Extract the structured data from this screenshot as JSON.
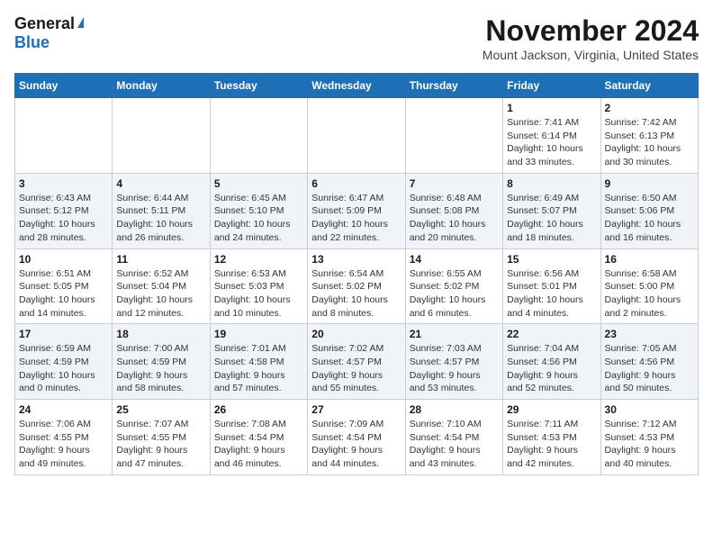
{
  "header": {
    "logo_general": "General",
    "logo_blue": "Blue",
    "month_title": "November 2024",
    "location": "Mount Jackson, Virginia, United States"
  },
  "weekdays": [
    "Sunday",
    "Monday",
    "Tuesday",
    "Wednesday",
    "Thursday",
    "Friday",
    "Saturday"
  ],
  "weeks": [
    [
      {
        "day": "",
        "info": ""
      },
      {
        "day": "",
        "info": ""
      },
      {
        "day": "",
        "info": ""
      },
      {
        "day": "",
        "info": ""
      },
      {
        "day": "",
        "info": ""
      },
      {
        "day": "1",
        "info": "Sunrise: 7:41 AM\nSunset: 6:14 PM\nDaylight: 10 hours\nand 33 minutes."
      },
      {
        "day": "2",
        "info": "Sunrise: 7:42 AM\nSunset: 6:13 PM\nDaylight: 10 hours\nand 30 minutes."
      }
    ],
    [
      {
        "day": "3",
        "info": "Sunrise: 6:43 AM\nSunset: 5:12 PM\nDaylight: 10 hours\nand 28 minutes."
      },
      {
        "day": "4",
        "info": "Sunrise: 6:44 AM\nSunset: 5:11 PM\nDaylight: 10 hours\nand 26 minutes."
      },
      {
        "day": "5",
        "info": "Sunrise: 6:45 AM\nSunset: 5:10 PM\nDaylight: 10 hours\nand 24 minutes."
      },
      {
        "day": "6",
        "info": "Sunrise: 6:47 AM\nSunset: 5:09 PM\nDaylight: 10 hours\nand 22 minutes."
      },
      {
        "day": "7",
        "info": "Sunrise: 6:48 AM\nSunset: 5:08 PM\nDaylight: 10 hours\nand 20 minutes."
      },
      {
        "day": "8",
        "info": "Sunrise: 6:49 AM\nSunset: 5:07 PM\nDaylight: 10 hours\nand 18 minutes."
      },
      {
        "day": "9",
        "info": "Sunrise: 6:50 AM\nSunset: 5:06 PM\nDaylight: 10 hours\nand 16 minutes."
      }
    ],
    [
      {
        "day": "10",
        "info": "Sunrise: 6:51 AM\nSunset: 5:05 PM\nDaylight: 10 hours\nand 14 minutes."
      },
      {
        "day": "11",
        "info": "Sunrise: 6:52 AM\nSunset: 5:04 PM\nDaylight: 10 hours\nand 12 minutes."
      },
      {
        "day": "12",
        "info": "Sunrise: 6:53 AM\nSunset: 5:03 PM\nDaylight: 10 hours\nand 10 minutes."
      },
      {
        "day": "13",
        "info": "Sunrise: 6:54 AM\nSunset: 5:02 PM\nDaylight: 10 hours\nand 8 minutes."
      },
      {
        "day": "14",
        "info": "Sunrise: 6:55 AM\nSunset: 5:02 PM\nDaylight: 10 hours\nand 6 minutes."
      },
      {
        "day": "15",
        "info": "Sunrise: 6:56 AM\nSunset: 5:01 PM\nDaylight: 10 hours\nand 4 minutes."
      },
      {
        "day": "16",
        "info": "Sunrise: 6:58 AM\nSunset: 5:00 PM\nDaylight: 10 hours\nand 2 minutes."
      }
    ],
    [
      {
        "day": "17",
        "info": "Sunrise: 6:59 AM\nSunset: 4:59 PM\nDaylight: 10 hours\nand 0 minutes."
      },
      {
        "day": "18",
        "info": "Sunrise: 7:00 AM\nSunset: 4:59 PM\nDaylight: 9 hours\nand 58 minutes."
      },
      {
        "day": "19",
        "info": "Sunrise: 7:01 AM\nSunset: 4:58 PM\nDaylight: 9 hours\nand 57 minutes."
      },
      {
        "day": "20",
        "info": "Sunrise: 7:02 AM\nSunset: 4:57 PM\nDaylight: 9 hours\nand 55 minutes."
      },
      {
        "day": "21",
        "info": "Sunrise: 7:03 AM\nSunset: 4:57 PM\nDaylight: 9 hours\nand 53 minutes."
      },
      {
        "day": "22",
        "info": "Sunrise: 7:04 AM\nSunset: 4:56 PM\nDaylight: 9 hours\nand 52 minutes."
      },
      {
        "day": "23",
        "info": "Sunrise: 7:05 AM\nSunset: 4:56 PM\nDaylight: 9 hours\nand 50 minutes."
      }
    ],
    [
      {
        "day": "24",
        "info": "Sunrise: 7:06 AM\nSunset: 4:55 PM\nDaylight: 9 hours\nand 49 minutes."
      },
      {
        "day": "25",
        "info": "Sunrise: 7:07 AM\nSunset: 4:55 PM\nDaylight: 9 hours\nand 47 minutes."
      },
      {
        "day": "26",
        "info": "Sunrise: 7:08 AM\nSunset: 4:54 PM\nDaylight: 9 hours\nand 46 minutes."
      },
      {
        "day": "27",
        "info": "Sunrise: 7:09 AM\nSunset: 4:54 PM\nDaylight: 9 hours\nand 44 minutes."
      },
      {
        "day": "28",
        "info": "Sunrise: 7:10 AM\nSunset: 4:54 PM\nDaylight: 9 hours\nand 43 minutes."
      },
      {
        "day": "29",
        "info": "Sunrise: 7:11 AM\nSunset: 4:53 PM\nDaylight: 9 hours\nand 42 minutes."
      },
      {
        "day": "30",
        "info": "Sunrise: 7:12 AM\nSunset: 4:53 PM\nDaylight: 9 hours\nand 40 minutes."
      }
    ]
  ]
}
